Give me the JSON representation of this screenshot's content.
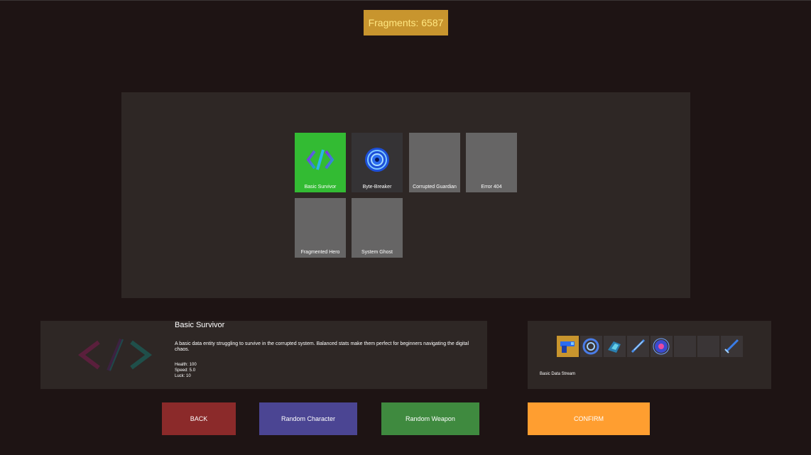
{
  "header": {
    "fragments_label": "Fragments: 6587"
  },
  "characters": [
    {
      "name": "Basic Survivor",
      "state": "selected",
      "icon": "code-brackets-icon"
    },
    {
      "name": "Byte-Breaker",
      "state": "owned",
      "icon": "blue-vortex-icon"
    },
    {
      "name": "Corrupted Guardian",
      "state": "locked"
    },
    {
      "name": "Error 404",
      "state": "locked"
    },
    {
      "name": "Fragmented Hero",
      "state": "locked"
    },
    {
      "name": "System Ghost",
      "state": "locked"
    }
  ],
  "selected_character": {
    "name": "Basic Survivor",
    "description": "A basic data entity struggling to survive in the corrupted system. Balanced stats make them perfect for beginners navigating the digital chaos.",
    "stats": {
      "health": "Health: 100",
      "speed": "Speed: 5.0",
      "luck": "Luck: 10"
    }
  },
  "weapons": {
    "slots": [
      "pistol-icon",
      "ring-vortex-icon",
      "gauntlet-icon",
      "blade-icon",
      "orb-icon",
      "empty",
      "empty",
      "sword-icon"
    ],
    "selected_index": 0,
    "selected_name": "Basic Data Stream"
  },
  "buttons": {
    "back": "BACK",
    "random_character": "Random Character",
    "random_weapon": "Random Weapon",
    "confirm": "CONFIRM"
  },
  "colors": {
    "background": "#1e1414",
    "panel": "#2e2725",
    "accent_gold": "#c8952e",
    "selected_green": "#33bb33",
    "confirm_orange": "#ff9e30"
  }
}
